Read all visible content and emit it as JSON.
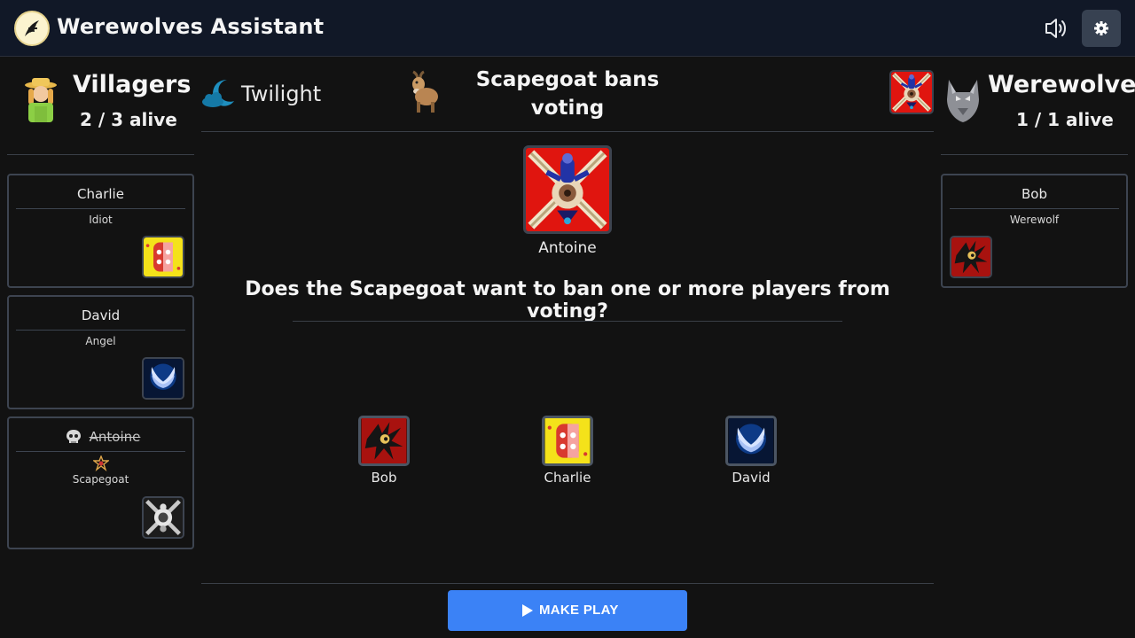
{
  "app": {
    "title": "Werewolves Assistant"
  },
  "colors": {
    "accent": "#3b82f6",
    "card_border": "#3d4450",
    "background": "#121212",
    "topbar": "#111827"
  },
  "icons": {
    "logo": "werewolf-logo-icon",
    "sound": "speaker-icon",
    "settings": "gear-icon",
    "phase": "moon-cloud-icon",
    "play": "play-icon",
    "dead": "skull-icon"
  },
  "villagers": {
    "title": "Villagers",
    "count": "2 / 3 alive",
    "players": [
      {
        "name": "Charlie",
        "role": "Idiot",
        "dead": false
      },
      {
        "name": "David",
        "role": "Angel",
        "dead": false
      },
      {
        "name": "Antoine",
        "role": "Scapegoat",
        "dead": true
      }
    ]
  },
  "werewolves": {
    "title": "Werewolves",
    "count": "1 / 1 alive",
    "players": [
      {
        "name": "Bob",
        "role": "Werewolf",
        "dead": false
      }
    ]
  },
  "phase": {
    "label": "Twilight"
  },
  "action": {
    "title": "Scapegoat bans voting",
    "source_player": "Antoine",
    "question": "Does the Scapegoat want to ban one or more players from voting?",
    "targets": [
      "Bob",
      "Charlie",
      "David"
    ]
  },
  "buttons": {
    "make_play": "MAKE PLAY"
  }
}
